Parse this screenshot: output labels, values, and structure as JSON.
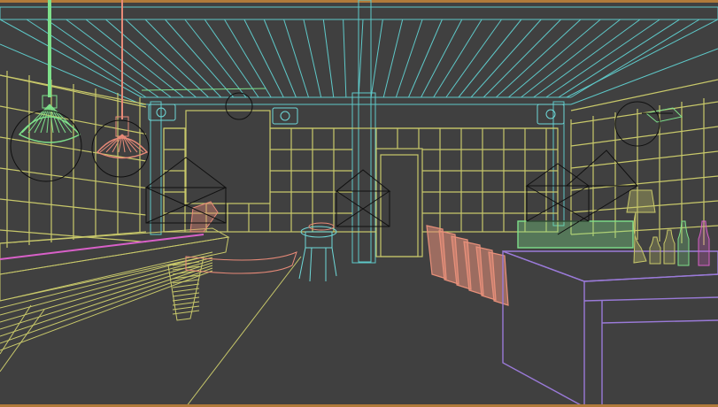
{
  "viewport": {
    "mode": "wireframe",
    "colors": {
      "background": "#404040",
      "ceiling": "#5ec8c8",
      "walls": "#c8c86a",
      "lamp_green": "#7ee08a",
      "lamp_red": "#e88a78",
      "chairs": "#e8907a",
      "stool": "#6ed8d8",
      "counter": "#9a7ad8",
      "bottles": "#d860c8",
      "camera": "#101010",
      "frame": "#b07a3a"
    }
  }
}
